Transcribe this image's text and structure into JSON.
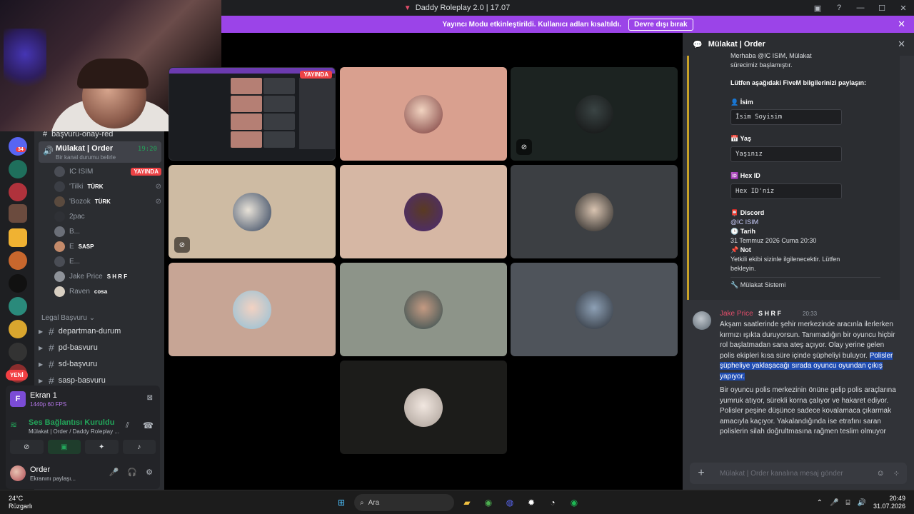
{
  "window": {
    "title": "Daddy Roleplay 2.0 | 17.07"
  },
  "banner": {
    "text": "Yayıncı Modu etkinleştirildi. Kullanıcı adları kısaltıldı.",
    "button": "Devre dışı bırak"
  },
  "sidebar": {
    "partial_channel": "başvuru-onay-red",
    "server_badge": "34",
    "new_badge": "YENİ",
    "voice_channel": {
      "name": "Mülakat | Order",
      "status": "Bir kanal durumu belirle",
      "time": "19:20"
    },
    "members": [
      {
        "name": "IC ISIM",
        "badge": "YAYINDA"
      },
      {
        "name": "'Tilki",
        "tag": "TÜRK"
      },
      {
        "name": "'Bozok",
        "tag": "TÜRK"
      },
      {
        "name": "2pac"
      },
      {
        "name": "B..."
      },
      {
        "name": "E",
        "tag": "SASP"
      },
      {
        "name": "E..."
      },
      {
        "name": "Jake Price",
        "tag": "S H R F"
      },
      {
        "name": "Raven",
        "tag": "cosa"
      }
    ],
    "category": "Legal Başvuru",
    "text_channels": [
      "departman-durum",
      "pd-basvuru",
      "sd-başvuru",
      "sasp-basvuru"
    ]
  },
  "panel": {
    "screen": {
      "title": "Ekran 1",
      "quality": "1440p 60 FPS"
    },
    "connection": {
      "title": "Ses Bağlantısı Kuruldu",
      "detail": "Mülakat | Order / Daddy Roleplay ..."
    },
    "user": {
      "name": "Order",
      "status": "Ekranını paylaşı..."
    }
  },
  "stream": {
    "live_label": "YAYINDA"
  },
  "chat": {
    "title": "Mülakat | Order",
    "embed": {
      "intro_partial": "Merhaba @IC ISIM, Mülakat sürecimiz başlamıştır.",
      "request": "Lütfen aşağıdaki FiveM bilgilerinizi paylaşın:",
      "fields": [
        {
          "label": "İsim",
          "value": "İsim Soyisim"
        },
        {
          "label": "Yaş",
          "value": "Yaşınız"
        },
        {
          "label": "Hex ID",
          "value": "Hex ID'niz"
        }
      ],
      "discord_label": "Discord",
      "discord_value": "@IC ISIM",
      "date_label": "Tarih",
      "date_value": "31 Temmuz 2026 Cuma 20:30",
      "note_label": "Not",
      "note_value": "Yetkili ekibi sizinle ilgilenecektir. Lütfen bekleyin.",
      "footer": "Mülakat Sistemi"
    },
    "message": {
      "author": "Jake Price",
      "tag": "S H R F",
      "time": "20:33",
      "text_1": "Akşam saatlerinde şehir merkezinde aracınla ilerlerken kırmızı ışıkta duruyorsun. Tanımadığın bir oyuncu hiçbir rol başlatmadan sana ateş açıyor. Olay yerine gelen polis ekipleri kısa süre içinde şüpheliyi buluyor.",
      "text_highlight": "Polisler şüpheliye yaklaşacağı sırada oyuncu oyundan çıkış yapıyor.",
      "text_2": "Bir oyuncu polis merkezinin önüne gelip polis araçlarına yumruk atıyor, sürekli korna çalıyor ve hakaret ediyor. Polisler peşine düşünce sadece kovalamaca çıkarmak amacıyla kaçıyor. Yakalandığında ise etrafını saran polislerin silah doğrultmasına rağmen teslim olmuyor"
    },
    "input_placeholder": "Mülakat | Order kanalına mesaj gönder"
  },
  "taskbar": {
    "weather_temp": "24°C",
    "weather_desc": "Rüzgarlı",
    "search": "Ara",
    "time": "20:49",
    "date": "31.07.2026"
  },
  "colors": {
    "accent": "#9b44e8",
    "live": "#ed4245",
    "online": "#23a55a"
  }
}
